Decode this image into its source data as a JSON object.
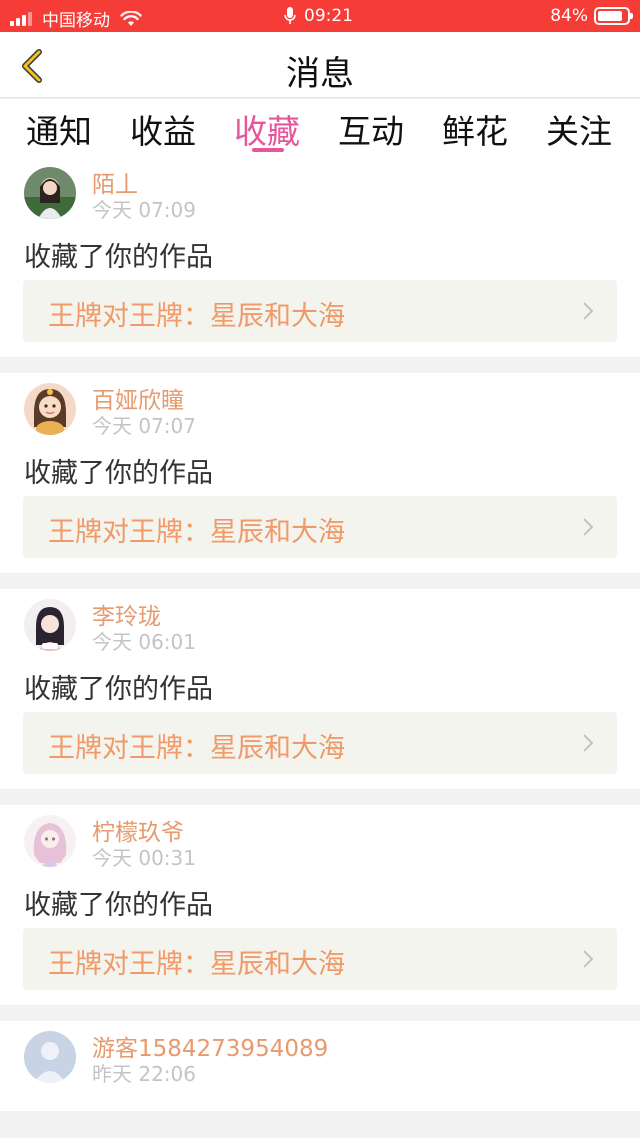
{
  "status_bar": {
    "carrier": "中国移动",
    "time": "09:21",
    "battery_percent": "84%",
    "battery_level": 0.84
  },
  "nav": {
    "title": "消息"
  },
  "tabs": [
    {
      "label": "通知",
      "active": false
    },
    {
      "label": "收益",
      "active": false
    },
    {
      "label": "收藏",
      "active": true
    },
    {
      "label": "互动",
      "active": false
    },
    {
      "label": "鲜花",
      "active": false
    },
    {
      "label": "关注",
      "active": false
    }
  ],
  "feed": [
    {
      "username": "陌丄",
      "time": "今天 07:09",
      "action": "收藏了你的作品",
      "work_title": "王牌对王牌：星辰和大海"
    },
    {
      "username": "百娅欣瞳",
      "time": "今天 07:07",
      "action": "收藏了你的作品",
      "work_title": "王牌对王牌：星辰和大海"
    },
    {
      "username": "李玲珑",
      "time": "今天 06:01",
      "action": "收藏了你的作品",
      "work_title": "王牌对王牌：星辰和大海"
    },
    {
      "username": "柠檬玖爷",
      "time": "今天 00:31",
      "action": "收藏了你的作品",
      "work_title": "王牌对王牌：星辰和大海"
    },
    {
      "username": "游客1584273954089",
      "time": "昨天 22:06"
    }
  ],
  "colors": {
    "status_bar_bg": "#f53c36",
    "accent_pink": "#e8559a",
    "username_orange": "#e79a6e",
    "work_title_orange": "#ef9a68",
    "back_arrow_yellow": "#f2c31a"
  }
}
